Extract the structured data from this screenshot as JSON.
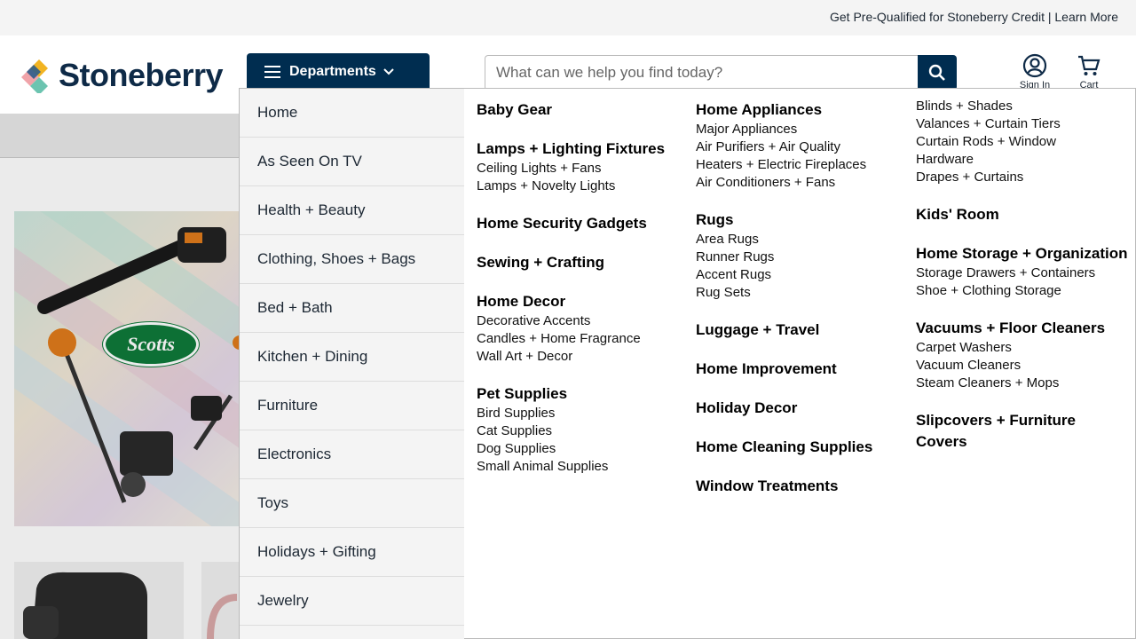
{
  "promo": {
    "text": "Get Pre-Qualified for Stoneberry Credit | Learn More"
  },
  "header": {
    "logo_text": "Stoneberry",
    "departments_label": "Departments",
    "search_placeholder": "What can we help you find today?",
    "signin_label": "Sign In",
    "cart_label": "Cart"
  },
  "hero": {
    "brand": "Scotts"
  },
  "menu": {
    "departments": [
      "Home",
      "As Seen On TV",
      "Health + Beauty",
      "Clothing, Shoes + Bags",
      "Bed + Bath",
      "Kitchen + Dining",
      "Furniture",
      "Electronics",
      "Toys",
      "Holidays + Gifting",
      "Jewelry"
    ],
    "col1": [
      {
        "title": "Baby Gear",
        "items": []
      },
      {
        "title": "Lamps + Lighting Fixtures",
        "items": [
          "Ceiling Lights + Fans",
          "Lamps + Novelty Lights"
        ]
      },
      {
        "title": "Home Security Gadgets",
        "items": []
      },
      {
        "title": "Sewing + Crafting",
        "items": []
      },
      {
        "title": "Home Decor",
        "items": [
          "Decorative Accents",
          "Candles + Home Fragrance",
          "Wall Art + Decor"
        ]
      },
      {
        "title": "Pet Supplies",
        "items": [
          "Bird Supplies",
          "Cat Supplies",
          "Dog Supplies",
          "Small Animal Supplies"
        ]
      }
    ],
    "col2": [
      {
        "title": "Home Appliances",
        "items": [
          "Major Appliances",
          "Air Purifiers + Air Quality",
          "Heaters + Electric Fireplaces",
          "Air Conditioners + Fans"
        ]
      },
      {
        "title": "Rugs",
        "items": [
          "Area Rugs",
          "Runner Rugs",
          "Accent Rugs",
          "Rug Sets"
        ]
      },
      {
        "title": "Luggage + Travel",
        "items": []
      },
      {
        "title": "Home Improvement",
        "items": []
      },
      {
        "title": "Holiday Decor",
        "items": []
      },
      {
        "title": "Home Cleaning Supplies",
        "items": []
      },
      {
        "title": "Window Treatments",
        "items": []
      }
    ],
    "col3_top_items": [
      "Blinds + Shades",
      "Valances + Curtain Tiers",
      "Curtain Rods + Window",
      "Hardware",
      "Drapes + Curtains"
    ],
    "col3": [
      {
        "title": "Kids' Room",
        "items": []
      },
      {
        "title": "Home Storage + Organization",
        "items": [
          "Storage Drawers + Containers",
          "Shoe + Clothing Storage"
        ]
      },
      {
        "title": "Vacuums + Floor Cleaners",
        "items": [
          "Carpet Washers",
          "Vacuum Cleaners",
          "Steam Cleaners + Mops"
        ]
      },
      {
        "title": "Slipcovers + Furniture Covers",
        "items": []
      }
    ]
  }
}
